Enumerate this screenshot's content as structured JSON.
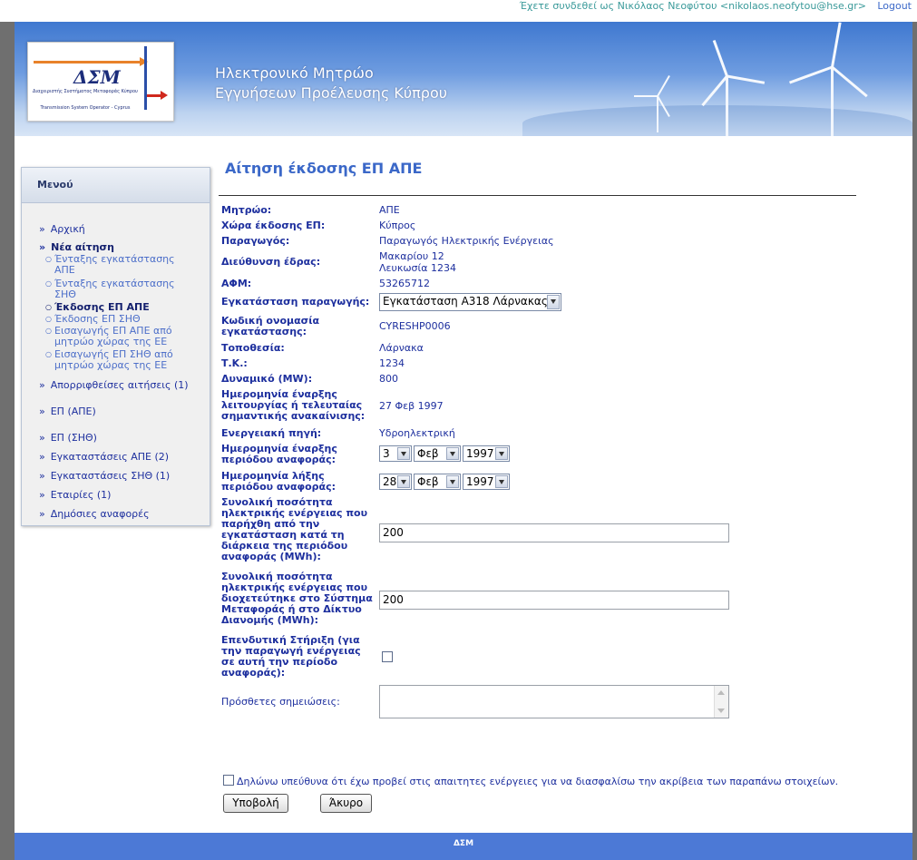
{
  "user": {
    "login_text": "Έχετε συνδεθεί ως Νικόλαος Νεοφύτου <nikolaos.neofytou@hse.gr>",
    "logout": "Logout"
  },
  "header": {
    "logo_mark": "ΔΣΜ",
    "logo_sub1": "Διαχειριστής Συστήματος Μεταφοράς Κύπρου",
    "logo_sub2": "Transmission System Operator - Cyprus",
    "title_line1": "Ηλεκτρονικό Μητρώο",
    "title_line2": "Εγγυήσεων Προέλευσης Κύπρου"
  },
  "menu": {
    "heading": "Μενού",
    "items": [
      {
        "label": "Αρχική"
      },
      {
        "label": "Νέα αίτηση",
        "sub": [
          "Ένταξης εγκατάστασης ΑΠΕ",
          "Ένταξης εγκατάστασης ΣΗΘ",
          "Έκδοσης ΕΠ ΑΠΕ",
          "Έκδοσης ΕΠ ΣΗΘ",
          "Εισαγωγής ΕΠ ΑΠΕ από μητρώο χώρας της ΕΕ",
          "Εισαγωγής ΕΠ ΣΗΘ από μητρώο χώρας της ΕΕ"
        ]
      },
      {
        "label": "Απορριφθείσες αιτήσεις (1)"
      },
      {
        "label": "ΕΠ (ΑΠΕ)"
      },
      {
        "label": "ΕΠ (ΣΗΘ)"
      },
      {
        "label": "Εγκαταστάσεις ΑΠΕ (2)"
      },
      {
        "label": "Εγκαταστάσεις ΣΗΘ (1)"
      },
      {
        "label": "Εταιρίες (1)"
      },
      {
        "label": "Δημόσιες αναφορές"
      }
    ]
  },
  "form": {
    "title": "Αίτηση έκδοσης ΕΠ ΑΠΕ",
    "registry_label": "Μητρώο:",
    "registry": "ΑΠΕ",
    "country_label": "Χώρα έκδοσης ΕΠ:",
    "country": "Κύπρος",
    "producer_label": "Παραγωγός:",
    "producer": "Παραγωγός Ηλεκτρικής Ενέργειας",
    "address_label": "Διεύθυνση έδρας:",
    "address_line1": "Μακαρίου 12",
    "address_line2": "Λευκωσία 1234",
    "vat_label": "ΑΦΜ:",
    "vat": "53265712",
    "plant_label": "Εγκατάσταση παραγωγής:",
    "plant": "Εγκατάσταση Α318 Λάρνακας",
    "code_label": "Κωδική ονομασία εγκατάστασης:",
    "code": "CYRESHP0006",
    "location_label": "Τοποθεσία:",
    "location": "Λάρνακα",
    "postcode_label": "Τ.Κ.:",
    "postcode": "1234",
    "capacity_label": "Δυναμικό (MW):",
    "capacity": "800",
    "start_label": "Ημερομηνία έναρξης λειτουργίας ή τελευταίας σημαντικής ανακαίνισης:",
    "start": "27 Φεβ 1997",
    "source_label": "Ενεργειακή πηγή:",
    "source": "Υδροηλεκτρική",
    "period_start_label": "Ημερομηνία έναρξης περιόδου αναφοράς:",
    "period_start": {
      "day": "3",
      "month": "Φεβ",
      "year": "1997"
    },
    "period_end_label": "Ημερομηνία λήξης περιόδου αναφοράς:",
    "period_end": {
      "day": "28",
      "month": "Φεβ",
      "year": "1997"
    },
    "produced_label": "Συνολική ποσότητα ηλεκτρικής ενέργειας που παρήχθη από την εγκατάσταση κατά τη διάρκεια της περιόδου αναφοράς (MWh):",
    "produced": "200",
    "delivered_label": "Συνολική ποσότητα ηλεκτρικής ενέργειας που διοχετεύτηκε στο Σύστημα Μεταφοράς ή στο Δίκτυο Διανομής (MWh):",
    "delivered": "200",
    "support_label": "Επενδυτική Στήριξη (για την παραγωγή ενέργειας σε αυτή την περίοδο αναφοράς):",
    "notes_label": "Πρόσθετες σημειώσεις:",
    "declaration": "Δηλώνω υπεύθυνα ότι έχω προβεί στις απαιτητες ενέργειες για να διασφαλίσω την ακρίβεια των παραπάνω στοιχείων.",
    "submit": "Υποβολή",
    "cancel": "Άκυρο"
  },
  "footer": {
    "text": "ΔΣΜ"
  }
}
